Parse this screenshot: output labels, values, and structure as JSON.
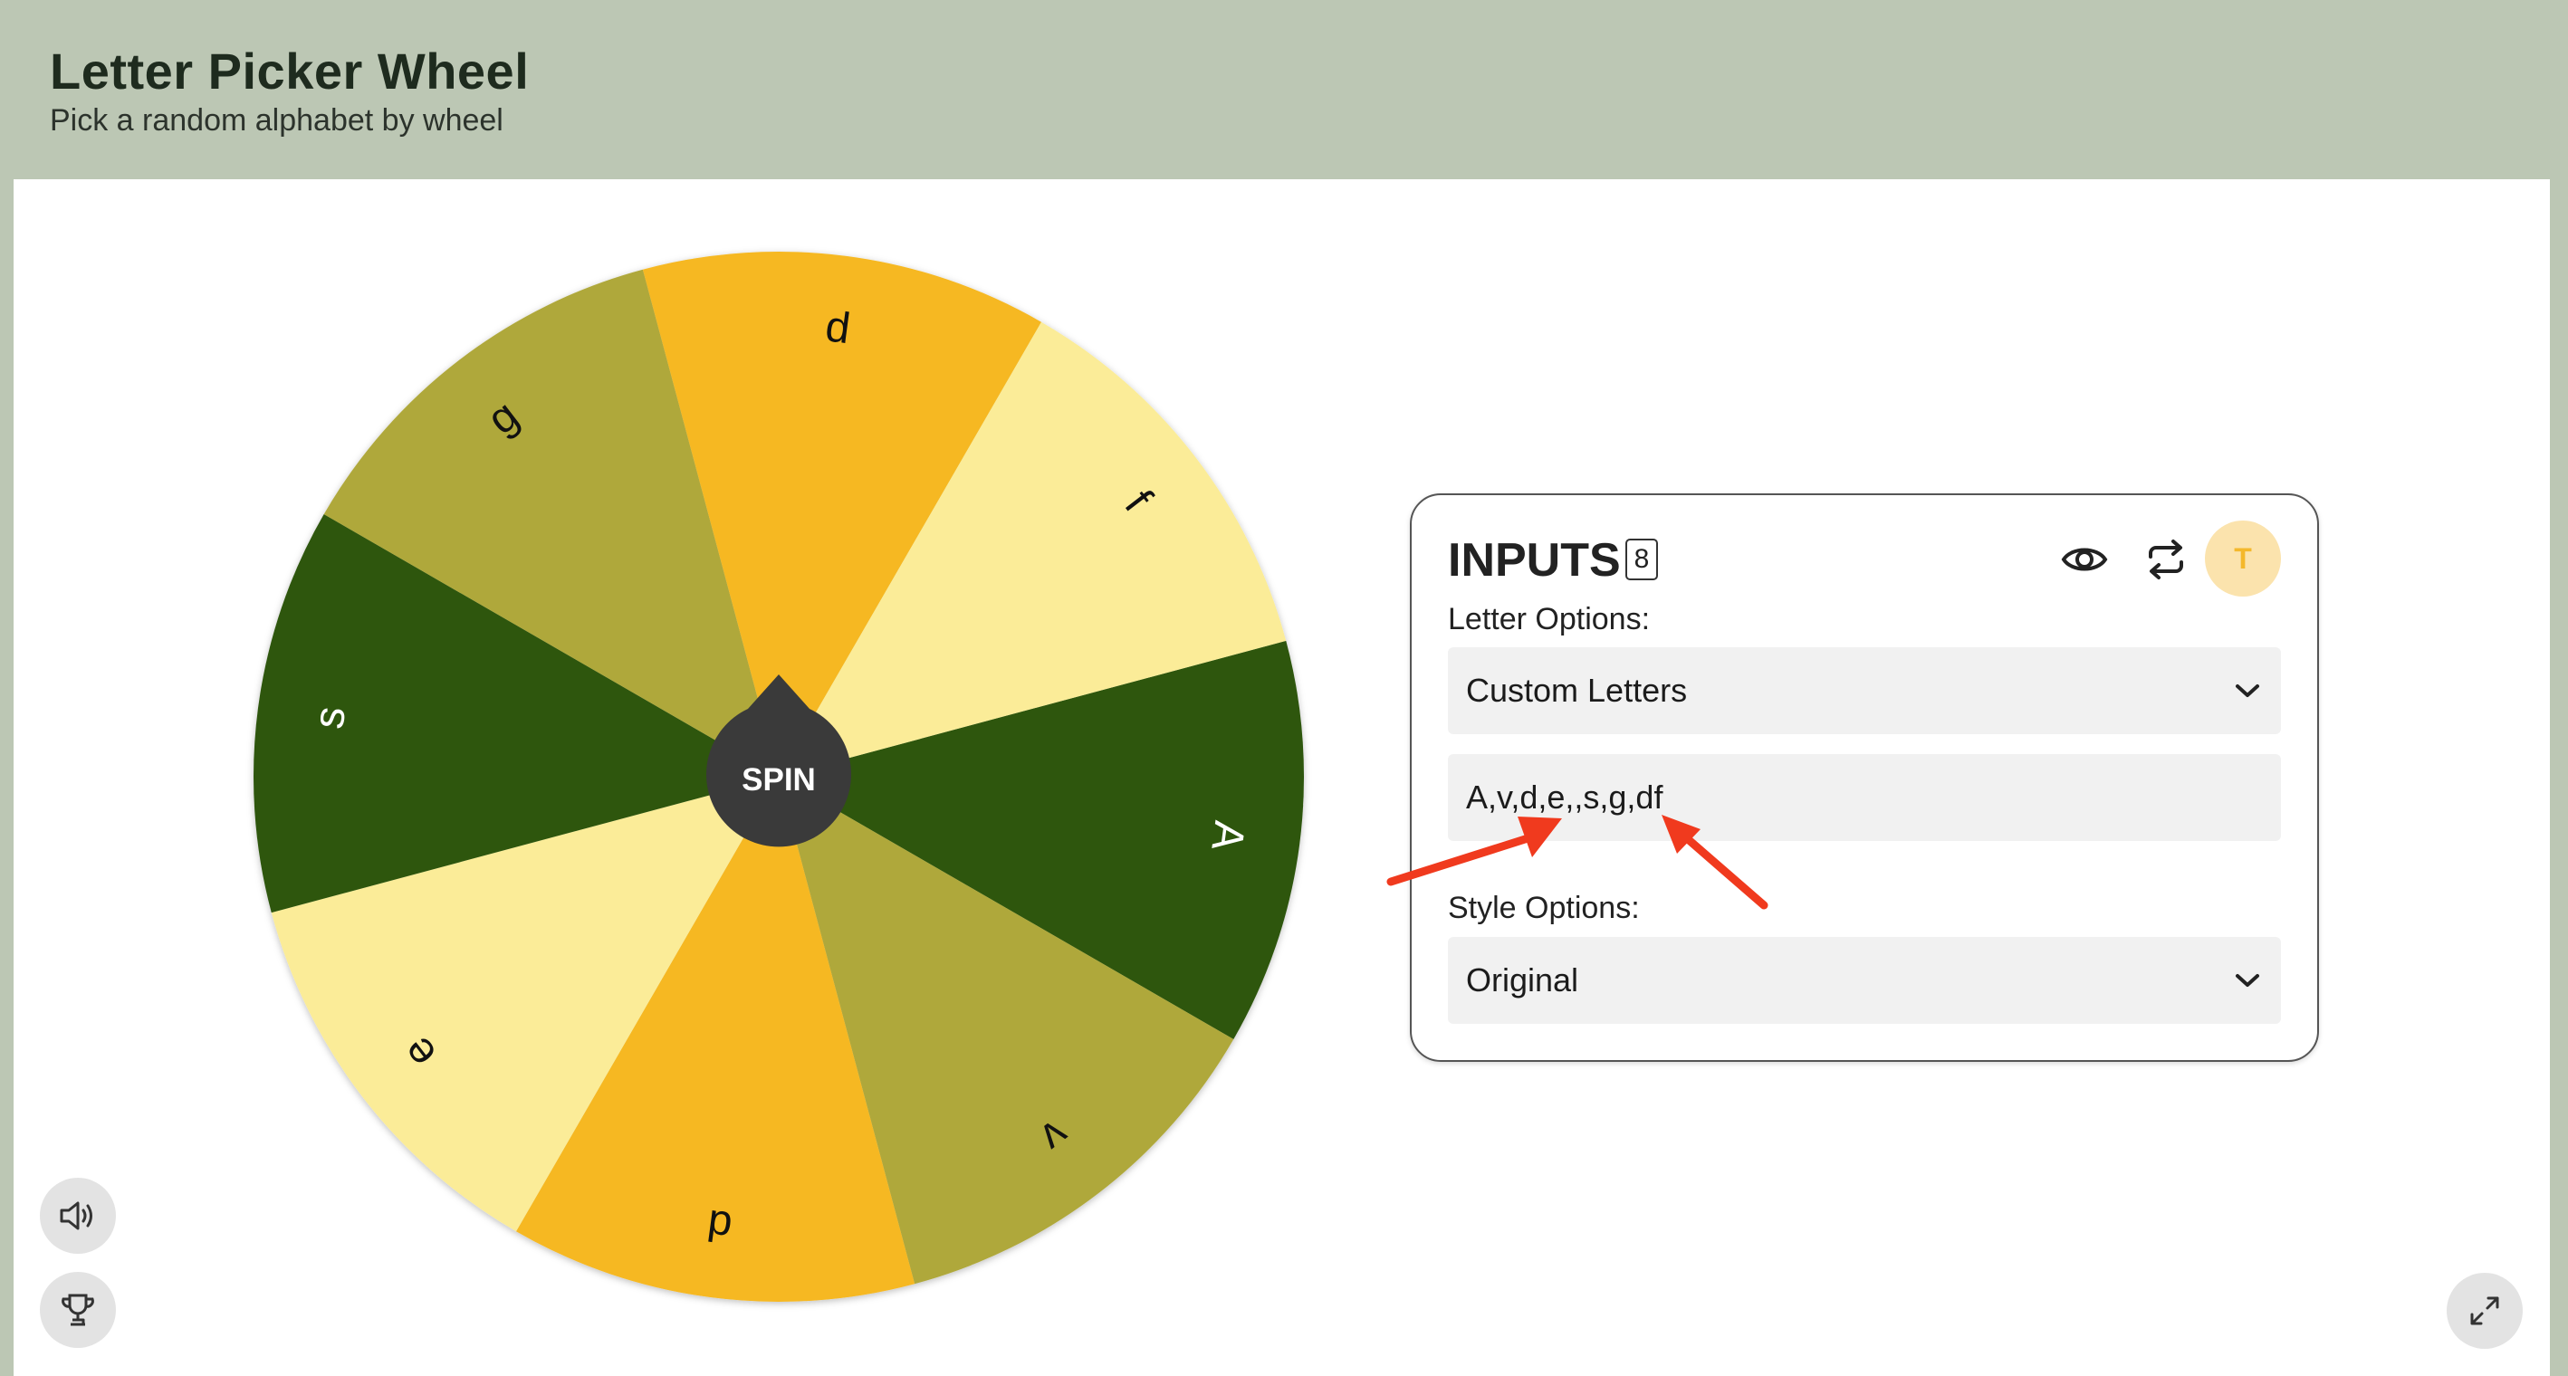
{
  "header": {
    "title": "Letter Picker Wheel",
    "subtitle": "Pick a random alphabet by wheel"
  },
  "wheel": {
    "segments": [
      {
        "letter": "A",
        "color": "#2d570f",
        "text_color": "#ffffff"
      },
      {
        "letter": "v",
        "color": "#afa83a",
        "text_color": "#111111"
      },
      {
        "letter": "d",
        "color": "#f6b820",
        "text_color": "#111111"
      },
      {
        "letter": "e",
        "color": "#fbec98",
        "text_color": "#111111"
      },
      {
        "letter": "s",
        "color": "#2d570f",
        "text_color": "#ffffff"
      },
      {
        "letter": "g",
        "color": "#afa83a",
        "text_color": "#111111"
      },
      {
        "letter": "d",
        "color": "#f6b820",
        "text_color": "#111111"
      },
      {
        "letter": "f",
        "color": "#fbec98",
        "text_color": "#111111"
      }
    ],
    "spin_label": "SPIN",
    "spin_color": "#3a3a3a"
  },
  "inputs": {
    "title": "INPUTS",
    "count": "8",
    "avatar_letter": "T",
    "letter_options_label": "Letter Options:",
    "letter_options_value": "Custom Letters",
    "custom_letters_value": "A,v,d,e,,s,g,df",
    "style_options_label": "Style Options:",
    "style_options_value": "Original"
  },
  "annotation_color": "#f03a1e",
  "icons": {
    "visibility": "eye-icon",
    "shuffle": "repeat-icon",
    "sound": "speaker-icon",
    "results": "trophy-icon",
    "fullscreen": "expand-icon"
  }
}
